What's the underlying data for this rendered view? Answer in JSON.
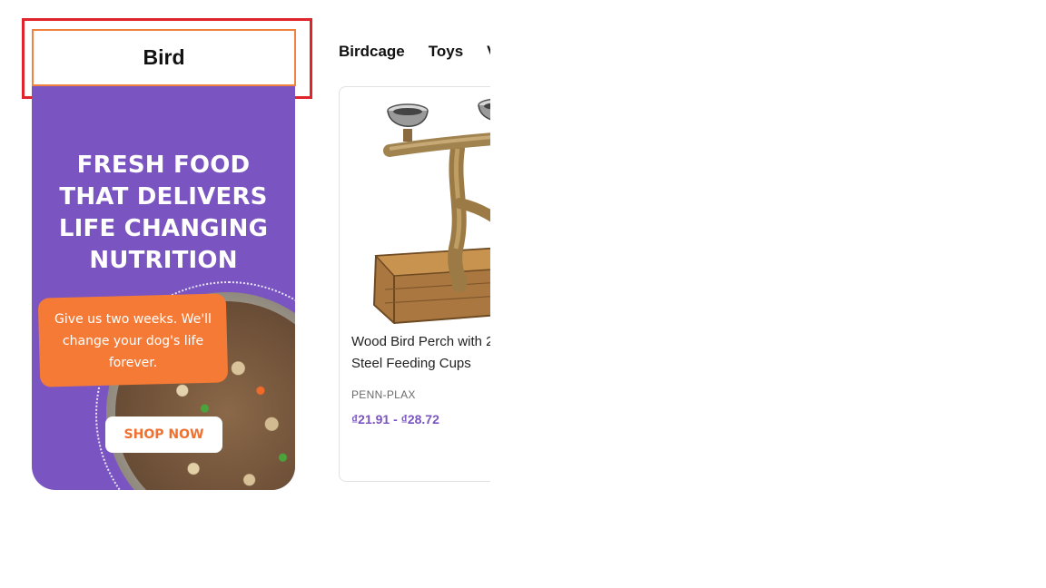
{
  "category": {
    "title": "Bird"
  },
  "promo": {
    "headline_lines": [
      "FRESH FOOD",
      "THAT DELIVERS",
      "LIFE CHANGING",
      "NUTRITION"
    ],
    "tag_lines": [
      "Give us two weeks. We'll",
      "change your dog's life",
      "forever."
    ],
    "cta_label": "SHOP NOW",
    "colors": {
      "background": "#7a55c1",
      "tag": "#f57a36",
      "cta_text": "#f07030",
      "highlight": "#e0242b",
      "header_border": "#f0813f"
    }
  },
  "tabs": [
    {
      "label": "Birdcage"
    },
    {
      "label": "Toys"
    },
    {
      "label": "V"
    }
  ],
  "product": {
    "title_line1": "Wood Bird Perch with 2",
    "title_line2": "Steel Feeding Cups",
    "brand": "PENN-PLAX",
    "price": "₫21.91 - ₫28.72",
    "image_icon": "bird-perch-icon"
  }
}
